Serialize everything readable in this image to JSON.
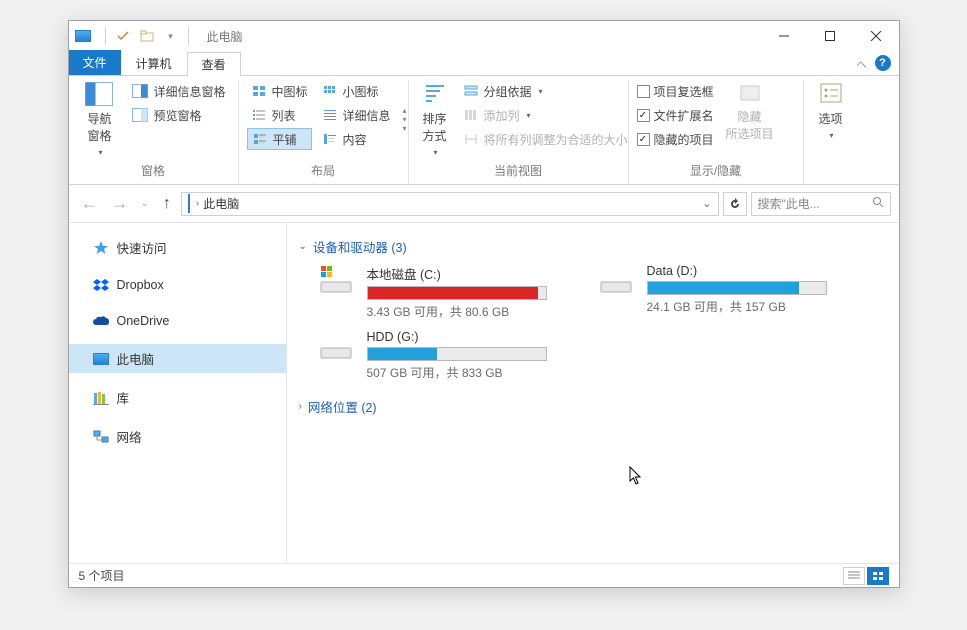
{
  "titlebar": {
    "title": "此电脑"
  },
  "tabs": {
    "file": "文件",
    "computer": "计算机",
    "view": "查看"
  },
  "ribbon": {
    "panes": {
      "nav_pane": "导航窗格",
      "preview_pane": "预览窗格",
      "details_pane": "详细信息窗格",
      "group_label": "窗格"
    },
    "layout": {
      "medium_icons": "中图标",
      "small_icons": "小图标",
      "list": "列表",
      "details": "详细信息",
      "tiles": "平铺",
      "content": "内容",
      "group_label": "布局"
    },
    "current_view": {
      "sort_by": "排序方式",
      "group_by": "分组依据",
      "add_columns": "添加列",
      "size_all": "将所有列调整为合适的大小",
      "group_label": "当前视图"
    },
    "show_hide": {
      "item_checkboxes": "项目复选框",
      "file_extensions": "文件扩展名",
      "hidden_items": "隐藏的项目",
      "hide_selected": "隐藏",
      "hide_selected_sub": "所选项目",
      "group_label": "显示/隐藏"
    },
    "options": "选项"
  },
  "address": {
    "crumb": "此电脑"
  },
  "search": {
    "placeholder": "搜索\"此电..."
  },
  "sidebar": {
    "items": [
      {
        "label": "快速访问",
        "icon": "star",
        "color": "#3f9fe8"
      },
      {
        "label": "Dropbox",
        "icon": "dropbox",
        "color": "#0062ff"
      },
      {
        "label": "OneDrive",
        "icon": "onedrive",
        "color": "#0f4f9e"
      },
      {
        "label": "此电脑",
        "icon": "pc",
        "selected": true
      },
      {
        "label": "库",
        "icon": "library",
        "color": "#f9b233"
      },
      {
        "label": "网络",
        "icon": "network",
        "color": "#3f9fe8"
      }
    ]
  },
  "content": {
    "devices_header": "设备和驱动器 (3)",
    "network_header": "网络位置 (2)",
    "drives": [
      {
        "name": "本地磁盘 (C:)",
        "status": "3.43 GB 可用，共 80.6 GB",
        "fill_pct": 96,
        "color": "#da2626",
        "os_drive": true
      },
      {
        "name": "Data (D:)",
        "status": "24.1 GB 可用，共 157 GB",
        "fill_pct": 85,
        "color": "#22a0dc"
      },
      {
        "name": "HDD (G:)",
        "status": "507 GB 可用，共 833 GB",
        "fill_pct": 39,
        "color": "#22a0dc"
      }
    ]
  },
  "statusbar": {
    "text": "5 个项目"
  }
}
